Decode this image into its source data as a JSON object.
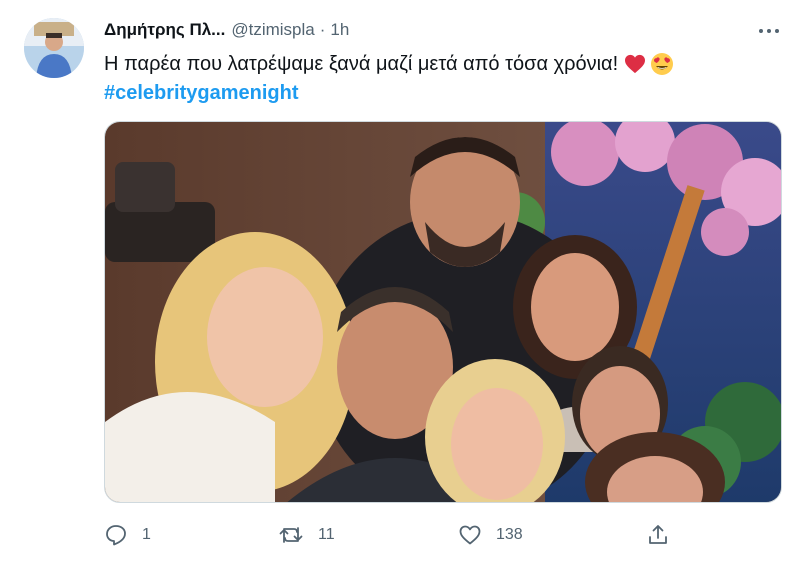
{
  "tweet": {
    "author_name": "Δημήτρης Πλ...",
    "handle": "@tzimispla",
    "separator": "·",
    "time": "1h",
    "text": "Η παρέα που λατρέψαμε ξανά μαζί μετά από τόσα χρόνια!",
    "emojis": [
      "red-heart",
      "heart-eyes-smiley"
    ],
    "hashtag": "#celebritygamenight"
  },
  "actions": {
    "reply_count": "1",
    "retweet_count": "11",
    "like_count": "138"
  },
  "colors": {
    "link": "#1d9bf0",
    "secondary_text": "#536471",
    "primary_text": "#0f1419",
    "heart": "#e0245e"
  },
  "icons": [
    "more-options-icon",
    "reply-icon",
    "retweet-icon",
    "like-icon",
    "share-icon"
  ]
}
